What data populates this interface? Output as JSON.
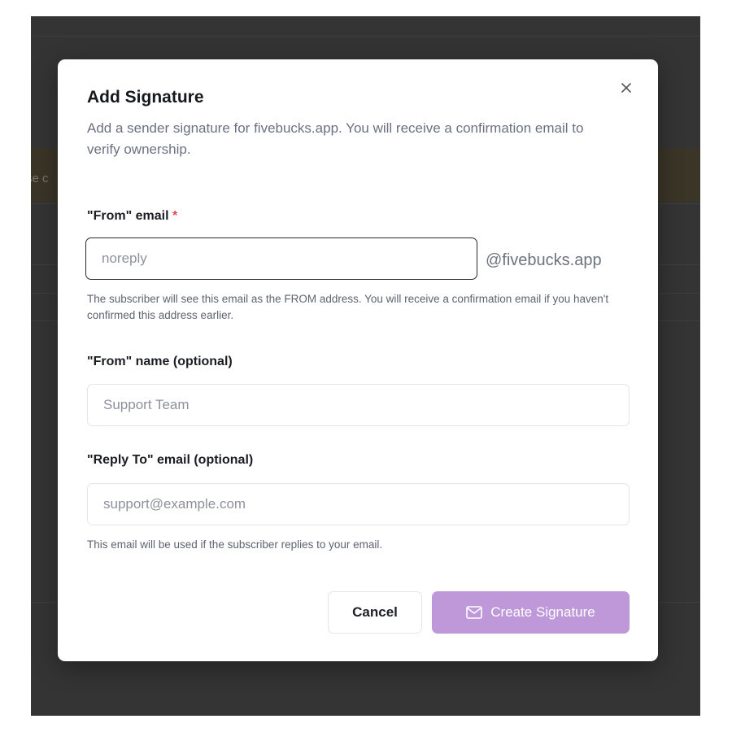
{
  "background": {
    "partial_text": "se c"
  },
  "dialog": {
    "title": "Add Signature",
    "description": "Add a sender signature for fivebucks.app. You will receive a confirmation email to verify ownership.",
    "close_icon": "close-icon",
    "from_email": {
      "label": "\"From\" email",
      "required_marker": "*",
      "placeholder": "noreply",
      "value": "",
      "suffix": "@fivebucks.app",
      "hint": "The subscriber will see this email as the FROM address. You will receive a confirmation email if you haven't confirmed this address earlier."
    },
    "from_name": {
      "label": "\"From\" name (optional)",
      "placeholder": "Support Team",
      "value": ""
    },
    "reply_to": {
      "label": "\"Reply To\" email (optional)",
      "placeholder": "support@example.com",
      "value": "",
      "hint": "This email will be used if the subscriber replies to your email."
    },
    "buttons": {
      "cancel": "Cancel",
      "create": "Create Signature",
      "create_icon": "mail-icon"
    }
  },
  "colors": {
    "primary_button": "#bf98d9",
    "required": "#e5484d"
  }
}
